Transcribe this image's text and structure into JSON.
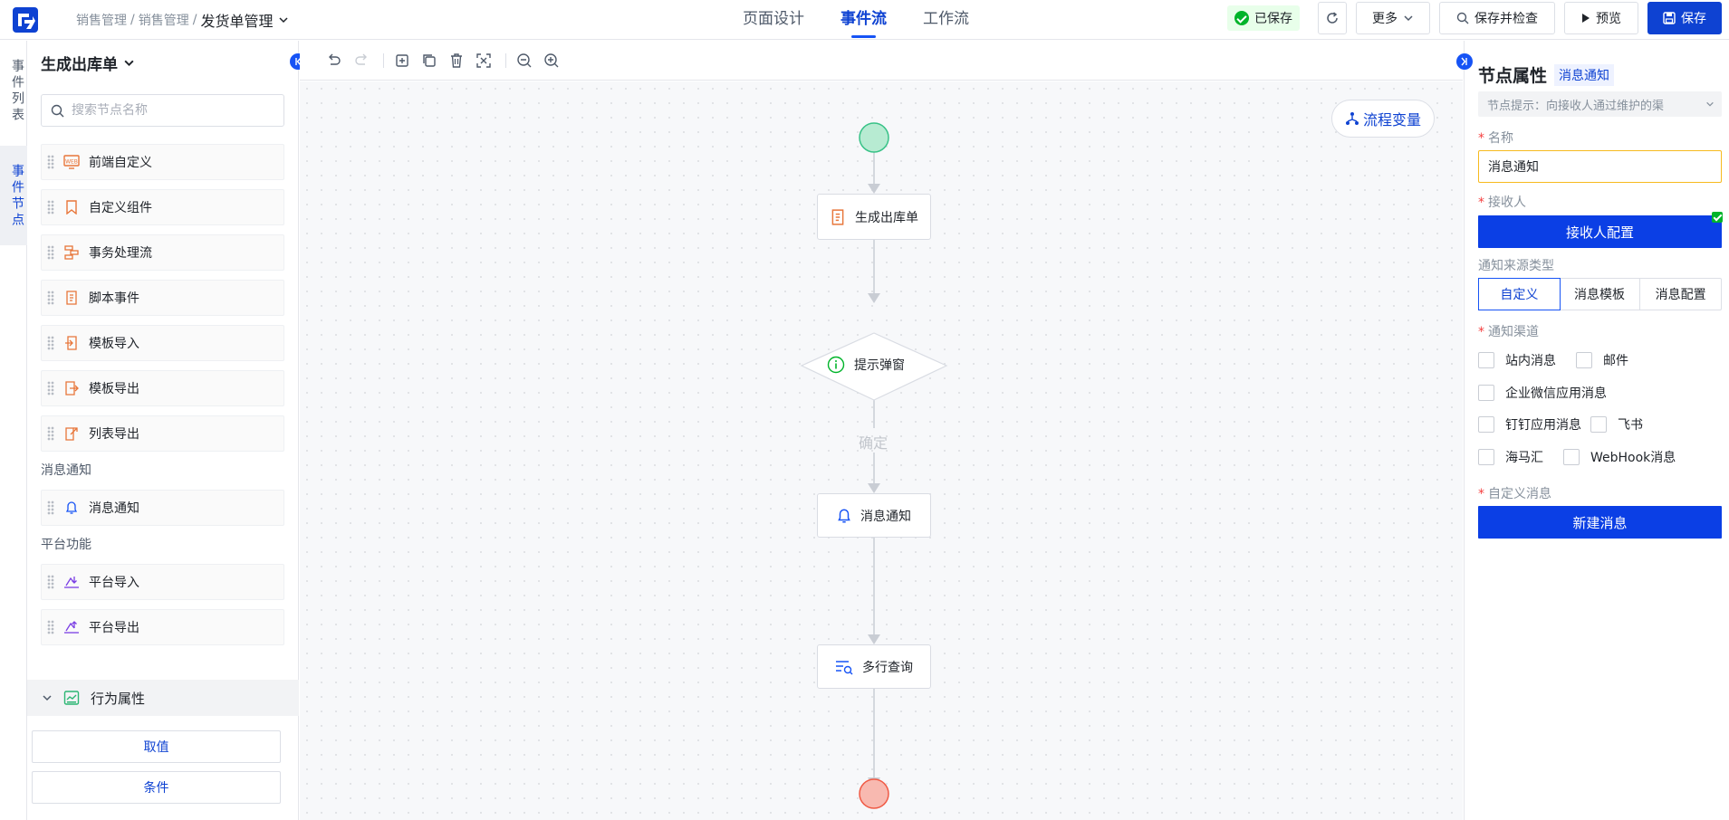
{
  "header": {
    "breadcrumb": [
      "销售管理",
      "销售管理",
      "发货单管理"
    ],
    "separator": "/",
    "tabs": [
      {
        "label": "页面设计",
        "active": false
      },
      {
        "label": "事件流",
        "active": true
      },
      {
        "label": "工作流",
        "active": false
      }
    ],
    "saved_label": "已保存",
    "more_label": "更多",
    "save_check_label": "保存并检查",
    "preview_label": "预览",
    "save_label": "保存"
  },
  "vertical_tabs": [
    {
      "label": "事件列表",
      "active": false
    },
    {
      "label": "事件节点",
      "active": true
    }
  ],
  "left_panel": {
    "title": "生成出库单",
    "search_placeholder": "搜索节点名称",
    "nodes": [
      {
        "label": "前端自定义",
        "icon": "web-icon"
      },
      {
        "label": "自定义组件",
        "icon": "bookmark-icon"
      },
      {
        "label": "事务处理流",
        "icon": "transaction-flow-icon"
      },
      {
        "label": "脚本事件",
        "icon": "script-icon"
      },
      {
        "label": "模板导入",
        "icon": "template-import-icon"
      },
      {
        "label": "模板导出",
        "icon": "template-export-icon"
      },
      {
        "label": "列表导出",
        "icon": "list-export-icon"
      }
    ],
    "section_message": "消息通知",
    "message_nodes": [
      {
        "label": "消息通知",
        "icon": "bell-icon"
      }
    ],
    "section_platform": "平台功能",
    "platform_nodes": [
      {
        "label": "平台导入",
        "icon": "platform-import-icon"
      },
      {
        "label": "平台导出",
        "icon": "platform-export-icon"
      }
    ],
    "behavior_label": "行为属性",
    "value_button": "取值",
    "condition_button": "条件"
  },
  "canvas": {
    "flow_variables_label": "流程变量",
    "nodes": {
      "generate": "生成出库单",
      "prompt": "提示弹窗",
      "confirm_edge": "确定",
      "message": "消息通知",
      "query": "多行查询"
    },
    "colors": {
      "start": "#b7ebd2",
      "end": "#f8b9b0",
      "edge": "#c9cdd4"
    }
  },
  "right_panel": {
    "title": "节点属性",
    "title_tag": "消息通知",
    "hint": "节点提示：向接收人通过维护的渠",
    "name_label": "名称",
    "name_value": "消息通知",
    "receiver_label": "接收人",
    "receiver_button": "接收人配置",
    "source_type_label": "通知来源类型",
    "source_types": [
      {
        "label": "自定义",
        "active": true
      },
      {
        "label": "消息模板",
        "active": false
      },
      {
        "label": "消息配置",
        "active": false
      }
    ],
    "channel_label": "通知渠道",
    "channels": [
      "站内消息",
      "邮件",
      "企业微信应用消息",
      "钉钉应用消息",
      "飞书",
      "海马汇",
      "WebHook消息"
    ],
    "custom_message_label": "自定义消息",
    "new_message_button": "新建消息"
  }
}
